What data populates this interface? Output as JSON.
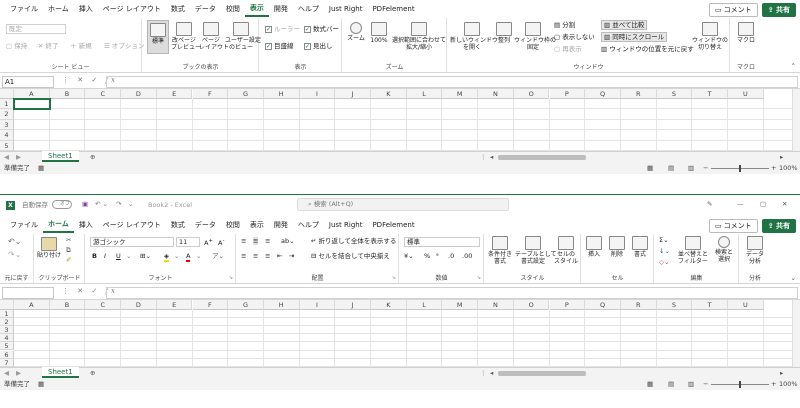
{
  "win1": {
    "tabs": [
      "ファイル",
      "ホーム",
      "挿入",
      "ページ レイアウト",
      "数式",
      "データ",
      "校閲",
      "表示",
      "開発",
      "ヘルプ",
      "Just Right",
      "PDFelement"
    ],
    "active_tab": "表示",
    "comment_label": "コメント",
    "share_label": "共有",
    "sheetview": {
      "dropdown": "既定",
      "keep": "保持",
      "exit": "終了",
      "new": "新規",
      "options": "オプション",
      "label": "シート ビュー"
    },
    "bookview": {
      "normal": "標準",
      "pagebreak": "改ページ\nプレビュー",
      "pagelayout": "ページ\nレイアウト",
      "custom": "ユーザー設定\nのビュー",
      "label": "ブックの表示"
    },
    "show": {
      "ruler": "ルーラー",
      "gridlines": "目盛線",
      "formulabar": "数式バー",
      "headings": "見出し",
      "label": "表示"
    },
    "zoom": {
      "zoom": "ズーム",
      "z100": "100%",
      "fit": "選択範囲に合わせて\n拡大/縮小",
      "label": "ズーム"
    },
    "window": {
      "newwin": "新しいウィンドウ\nを開く",
      "arrange": "整列",
      "freeze": "ウィンドウ枠の\n固定",
      "split": "分割",
      "hide": "表示しない",
      "unhide": "再表示",
      "sidebyside": "並べて比較",
      "syncscroll": "同時にスクロール",
      "reset": "ウィンドウの位置を元に戻す",
      "switch": "ウィンドウの\n切り替え",
      "label": "ウィンドウ"
    },
    "macro": {
      "macro": "マクロ",
      "label": "マクロ"
    },
    "namebox": "A1",
    "sheet": "Sheet1",
    "status": "準備完了",
    "zoom_value": "100%"
  },
  "win2": {
    "autosave": "自動保存",
    "autosave_state": "オフ",
    "title": "Book2 - Excel",
    "search": "検索 (Alt+Q)",
    "tabs": [
      "ファイル",
      "ホーム",
      "挿入",
      "ページ レイアウト",
      "数式",
      "データ",
      "校閲",
      "表示",
      "開発",
      "ヘルプ",
      "Just Right",
      "PDFelement"
    ],
    "active_tab": "ホーム",
    "comment_label": "コメント",
    "share_label": "共有",
    "undo_label": "元に戻す",
    "clipboard": {
      "paste": "貼り付け",
      "label": "クリップボード"
    },
    "font": {
      "name": "游ゴシック",
      "size": "11",
      "label": "フォント"
    },
    "align": {
      "wrap": "折り返して全体を表示する",
      "merge": "セルを結合して中央揃え",
      "label": "配置"
    },
    "number": {
      "format": "標準",
      "label": "数値"
    },
    "styles": {
      "cond": "条件付き\n書式",
      "table": "テーブルとして\n書式設定",
      "cellstyle": "セルの\nスタイル",
      "label": "スタイル"
    },
    "cells": {
      "insert": "挿入",
      "delete": "削除",
      "format": "書式",
      "label": "セル"
    },
    "editing": {
      "sort": "並べ替えと\nフィルター",
      "find": "検索と\n選択",
      "label": "編集"
    },
    "analysis": {
      "data": "データ\n分析",
      "label": "分析"
    },
    "sheet": "Sheet1",
    "status": "準備完了",
    "zoom_value": "100%"
  },
  "columns": [
    "A",
    "B",
    "C",
    "D",
    "E",
    "F",
    "G",
    "H",
    "I",
    "J",
    "K",
    "L",
    "M",
    "N",
    "O",
    "P",
    "Q",
    "R",
    "S",
    "T",
    "U"
  ],
  "rows1": [
    "1",
    "2",
    "3",
    "4",
    "5"
  ],
  "rows2": [
    "1",
    "2",
    "3",
    "4",
    "5",
    "6",
    "7"
  ],
  "colors": {
    "accent": "#217346"
  }
}
